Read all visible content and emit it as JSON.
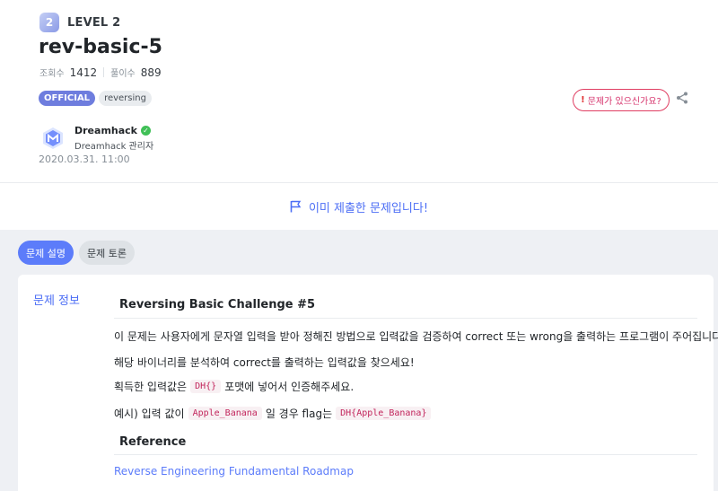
{
  "header": {
    "level_badge": "2",
    "level_text": "LEVEL 2",
    "title": "rev-basic-5",
    "stats": {
      "views_label": "조회수",
      "views": "1412",
      "solves_label": "풀이수",
      "solves": "889"
    },
    "tags": [
      "OFFICIAL",
      "reversing"
    ],
    "report_label": "문제가 있으신가요?",
    "author": {
      "name": "Dreamhack",
      "role": "Dreamhack 관리자"
    },
    "date": "2020.03.31. 11:00"
  },
  "submitted": {
    "text": "이미 제출한 문제입니다!"
  },
  "tabs": [
    {
      "label": "문제 설명",
      "active": true
    },
    {
      "label": "문제 토론",
      "active": false
    }
  ],
  "card": {
    "label": "문제 정보",
    "heading1": "Reversing Basic Challenge #5",
    "para1": "이 문제는 사용자에게 문자열 입력을 받아 정해진 방법으로 입력값을 검증하여 correct 또는 wrong을 출력하는 프로그램이 주어집니다.",
    "para2": "해당 바이너리를 분석하여 correct를 출력하는 입력값을 찾으세요!",
    "para3_pre": "획득한 입력값은",
    "para3_code": "DH{}",
    "para3_post": "포맷에 넣어서 인증해주세요.",
    "para4_pre": "예시) 입력 값이",
    "para4_code1": "Apple_Banana",
    "para4_mid": "일 경우 flag는",
    "para4_code2": "DH{Apple_Banana}",
    "heading2": "Reference",
    "link": "Reverse Engineering Fundamental Roadmap"
  },
  "colors": {
    "accent": "#4c6ef5",
    "official_tag": "#6e7dde",
    "report_border": "#e03e62",
    "verified": "#40c057"
  },
  "icons": [
    "level-icon",
    "report-icon",
    "share-icon",
    "dreamhack-logo-icon",
    "verified-icon",
    "flag-icon"
  ]
}
